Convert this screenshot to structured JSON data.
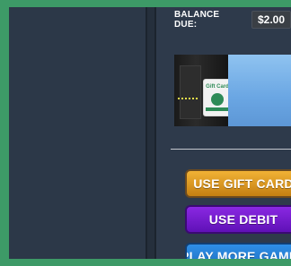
{
  "balance": {
    "label": "BALANCE DUE:",
    "value": "$2.00"
  },
  "promo": {
    "gift_card_text": "Gift Card"
  },
  "buttons": {
    "gift": "USE GIFT CARD",
    "debit": "USE DEBIT",
    "play": "PLAY MORE GAMES"
  },
  "colors": {
    "background_green": "#3d9a67",
    "panel_dark": "#2b3747",
    "gift_button": "#f1b235",
    "debit_button": "#8a28e2",
    "play_button": "#2f8fe6"
  }
}
